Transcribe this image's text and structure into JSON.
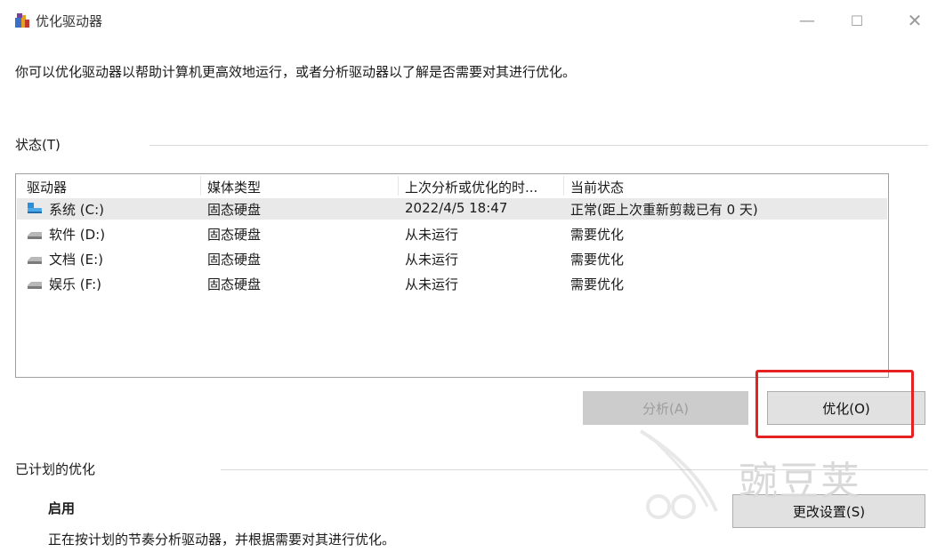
{
  "window": {
    "title": "优化驱动器",
    "minimize": "—",
    "maximize": "☐",
    "close": "✕"
  },
  "description": "你可以优化驱动器以帮助计算机更高效地运行，或者分析驱动器以了解是否需要对其进行优化。",
  "status_label": "状态(T)",
  "table": {
    "headers": [
      "驱动器",
      "媒体类型",
      "上次分析或优化的时...",
      "当前状态"
    ],
    "rows": [
      {
        "drive": "系统 (C:)",
        "media": "固态硬盘",
        "last": "2022/4/5 18:47",
        "status": "正常(距上次重新剪裁已有 0 天)",
        "icon": "system-drive-icon",
        "selected": true
      },
      {
        "drive": "软件 (D:)",
        "media": "固态硬盘",
        "last": "从未运行",
        "status": "需要优化",
        "icon": "drive-icon"
      },
      {
        "drive": "文档 (E:)",
        "media": "固态硬盘",
        "last": "从未运行",
        "status": "需要优化",
        "icon": "drive-icon"
      },
      {
        "drive": "娱乐 (F:)",
        "media": "固态硬盘",
        "last": "从未运行",
        "status": "需要优化",
        "icon": "drive-icon"
      }
    ]
  },
  "buttons": {
    "analyze": "分析(A)",
    "optimize": "优化(O)",
    "change_settings": "更改设置(S)"
  },
  "scheduled": {
    "label": "已计划的优化",
    "state": "启用",
    "description": "正在按计划的节奏分析驱动器，并根据需要对其进行优化。"
  },
  "watermark": "豌豆荚",
  "colors": {
    "highlight": "#e52222",
    "selected_row": "#e9e9e9",
    "disabled_button": "#cccccc"
  }
}
